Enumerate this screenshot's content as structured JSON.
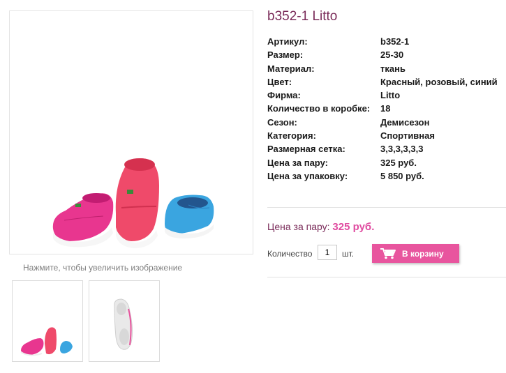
{
  "product": {
    "title": "b352-1 Litto",
    "zoom_hint": "Нажмите, чтобы увеличить изображение",
    "specs": [
      {
        "key": "Артикул:",
        "value": "b352-1"
      },
      {
        "key": "Размер:",
        "value": "25-30"
      },
      {
        "key": "Материал:",
        "value": "ткань"
      },
      {
        "key": "Цвет:",
        "value": "Красный, розовый, синий"
      },
      {
        "key": "Фирма:",
        "value": "Litto"
      },
      {
        "key": "Количество в коробке:",
        "value": "18"
      },
      {
        "key": "Сезон:",
        "value": "Демисезон"
      },
      {
        "key": "Категория:",
        "value": "Спортивная"
      },
      {
        "key": "Размерная сетка:",
        "value": "3,3,3,3,3,3"
      },
      {
        "key": "Цена за пару:",
        "value": "325 руб."
      },
      {
        "key": "Цена за упаковку:",
        "value": "5 850 руб."
      }
    ]
  },
  "purchase": {
    "price_label": "Цена за пару:",
    "price_value": "325 руб.",
    "qty_label": "Количество",
    "qty_value": "1",
    "qty_unit": "шт.",
    "cart_button": "В корзину",
    "cart_icon": "shopping-cart-icon"
  },
  "colors": {
    "title": "#7a2b59",
    "price": "#e04ba0",
    "button": "#e8559e"
  }
}
